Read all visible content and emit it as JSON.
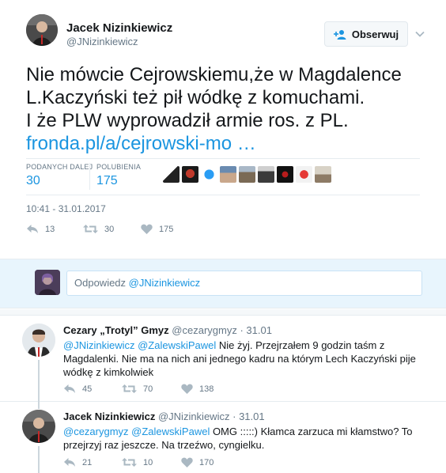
{
  "main_tweet": {
    "author_name": "Jacek Nizinkiewicz",
    "author_handle": "@JNizinkiewicz",
    "follow_label": "Obserwuj",
    "text_lines": [
      "Nie mówcie Cejrowskiemu,że w Magdalence",
      "L.Kaczyński też pił wódkę z komuchami.",
      "I że PLW wyprowadził armie ros. z PL."
    ],
    "link_text": "fronda.pl/a/cejrowski-mo …",
    "stats": {
      "retweets_label": "PODANYCH DALEJ",
      "retweets_value": "30",
      "likes_label": "POLUBIENIA",
      "likes_value": "175"
    },
    "timestamp": "10:41 - 31.01.2017",
    "actions": {
      "reply_count": "13",
      "retweet_count": "30",
      "like_count": "175"
    }
  },
  "reply_box": {
    "prefix": "Odpowiedz",
    "mention": "@JNizinkiewicz"
  },
  "replies": [
    {
      "name": "Cezary „Trotyl” Gmyz",
      "handle": "@cezarygmyz",
      "dot": "·",
      "date": "31.01",
      "line1_mentions": "@JNizinkiewicz @ZalewskiPawel",
      "line1_text": " Nie żyj. Przejrzałem 9 godzin taśm z",
      "line2": "Magdalenki. Nie ma na nich ani jednego kadru na którym Lech Kaczyński pije",
      "line3": "wódkę z kimkolwiek",
      "reply_count": "45",
      "retweet_count": "70",
      "like_count": "138"
    },
    {
      "name": "Jacek Nizinkiewicz",
      "handle": "@JNizinkiewicz",
      "dot": "·",
      "date": "31.01",
      "line1_mentions": "@cezarygmyz @ZalewskiPawel",
      "line1_text": " OMG :::::) Kłamca zarzuca mi kłamstwo? To",
      "line2": "przejrzyj raz jeszcze. Na trzeźwo, cyngielku.",
      "reply_count": "21",
      "retweet_count": "10",
      "like_count": "170"
    }
  ],
  "colors": {
    "link": "#1b95e0",
    "muted": "#657786",
    "reply_bg": "#e8f5fd"
  }
}
